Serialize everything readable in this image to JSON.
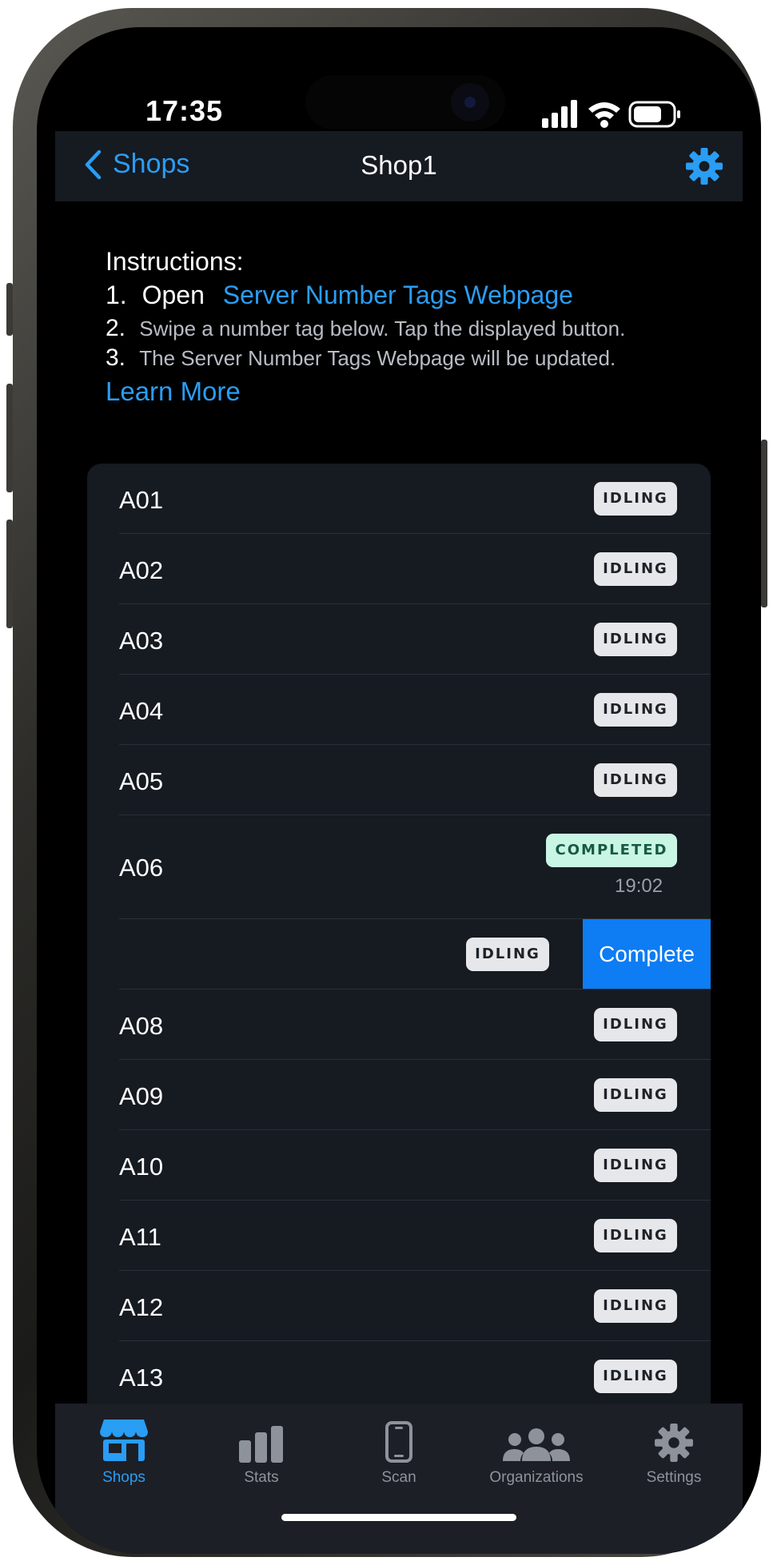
{
  "status_bar": {
    "time": "17:35"
  },
  "nav": {
    "back_label": "Shops",
    "title": "Shop1"
  },
  "instructions": {
    "title": "Instructions:",
    "step1_num": "1.",
    "step1_text": "Open",
    "step1_link": "Server Number Tags Webpage",
    "step2_num": "2.",
    "step2_text": "Swipe a number tag below.  Tap the displayed button.",
    "step3_num": "3.",
    "step3_text": "The Server Number Tags Webpage will be updated.",
    "learn_more": "Learn More"
  },
  "tags": [
    {
      "label": "A01",
      "status": "IDLING"
    },
    {
      "label": "A02",
      "status": "IDLING"
    },
    {
      "label": "A03",
      "status": "IDLING"
    },
    {
      "label": "A04",
      "status": "IDLING"
    },
    {
      "label": "A05",
      "status": "IDLING"
    },
    {
      "label": "A06",
      "status": "COMPLETED",
      "time": "19:02"
    },
    {
      "label": "",
      "status": "IDLING",
      "action": "Complete"
    },
    {
      "label": "A08",
      "status": "IDLING"
    },
    {
      "label": "A09",
      "status": "IDLING"
    },
    {
      "label": "A10",
      "status": "IDLING"
    },
    {
      "label": "A11",
      "status": "IDLING"
    },
    {
      "label": "A12",
      "status": "IDLING"
    },
    {
      "label": "A13",
      "status": "IDLING"
    }
  ],
  "tab_bar": {
    "tabs": [
      {
        "label": "Shops",
        "icon": "storefront-icon",
        "active": true
      },
      {
        "label": "Stats",
        "icon": "bar-chart-icon"
      },
      {
        "label": "Scan",
        "icon": "phone-icon"
      },
      {
        "label": "Organizations",
        "icon": "people-icon"
      },
      {
        "label": "Settings",
        "icon": "gear-icon"
      }
    ]
  },
  "colors": {
    "accent": "#2a9df4",
    "complete_action": "#0e7cf2",
    "completed_badge_bg": "#c9f5e4",
    "idle_badge_bg": "#e6e7ea",
    "list_bg": "#161a21"
  }
}
